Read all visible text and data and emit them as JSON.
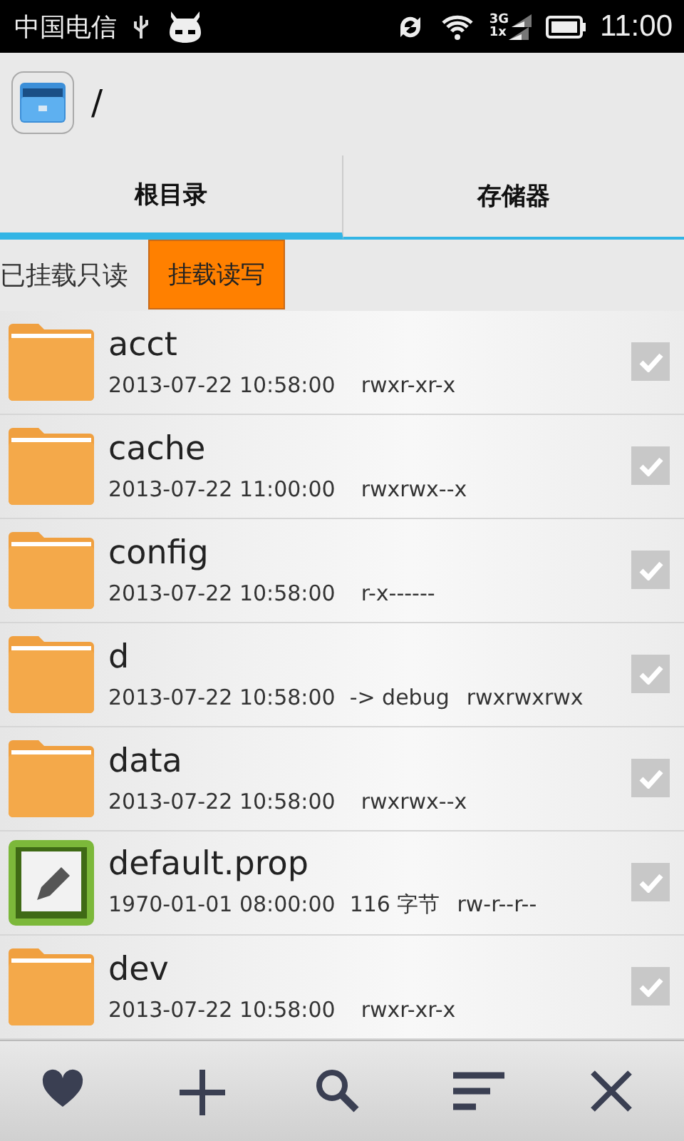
{
  "status_bar": {
    "carrier": "中国电信",
    "network_top": "3G",
    "network_bottom": "1x",
    "time": "11:00"
  },
  "header": {
    "path": "/"
  },
  "tabs": [
    {
      "label": "根目录",
      "selected": true
    },
    {
      "label": "存储器",
      "selected": false
    }
  ],
  "mount": {
    "status": "已挂载只读",
    "button": "挂载读写"
  },
  "files": [
    {
      "kind": "folder",
      "name": "acct",
      "date": "2013-07-22 10:58:00",
      "perms": "rwxr-xr-x",
      "checked": false
    },
    {
      "kind": "folder",
      "name": "cache",
      "date": "2013-07-22 11:00:00",
      "perms": "rwxrwx--x",
      "checked": false
    },
    {
      "kind": "folder",
      "name": "config",
      "date": "2013-07-22 10:58:00",
      "perms": "r-x------",
      "checked": false
    },
    {
      "kind": "folder",
      "name": "d",
      "date": "2013-07-22 10:58:00",
      "extra": "-> debug",
      "perms": "rwxrwxrwx",
      "checked": false
    },
    {
      "kind": "folder",
      "name": "data",
      "date": "2013-07-22 10:58:00",
      "perms": "rwxrwx--x",
      "checked": false
    },
    {
      "kind": "file",
      "name": "default.prop",
      "date": "1970-01-01 08:00:00",
      "extra": "116 字节",
      "perms": "rw-r--r--",
      "checked": false
    },
    {
      "kind": "folder",
      "name": "dev",
      "date": "2013-07-22 10:58:00",
      "perms": "rwxr-xr-x",
      "checked": false
    }
  ]
}
